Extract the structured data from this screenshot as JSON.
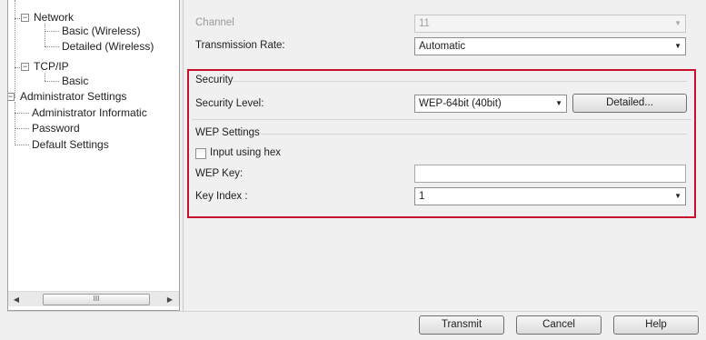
{
  "tree": {
    "items": [
      {
        "label": "Network"
      },
      {
        "label": "Basic (Wireless)"
      },
      {
        "label": "Detailed (Wireless)"
      },
      {
        "label": "TCP/IP"
      },
      {
        "label": "Basic"
      },
      {
        "label": "Administrator Settings"
      },
      {
        "label": "Administrator Informatic"
      },
      {
        "label": "Password"
      },
      {
        "label": "Default Settings"
      }
    ],
    "expanders": [
      "−",
      "−",
      "−"
    ],
    "scrollbar": {
      "left_arrow": "◀",
      "right_arrow": "▶",
      "thumb_grip": "III"
    }
  },
  "form": {
    "channel": {
      "label": "Channel",
      "value": "11"
    },
    "transmission_rate": {
      "label": "Transmission Rate:",
      "value": "Automatic"
    },
    "security": {
      "heading": "Security",
      "level_label": "Security Level:",
      "level_value": "WEP-64bit (40bit)",
      "detailed_button": "Detailed..."
    },
    "wep": {
      "heading": "WEP Settings",
      "hex_checkbox_label": "Input using hex",
      "hex_checked": false,
      "key_label": "WEP Key:",
      "key_value": "",
      "index_label": "Key Index :",
      "index_value": "1"
    },
    "dropdown_arrow": "▼"
  },
  "buttons": {
    "transmit": "Transmit",
    "cancel": "Cancel",
    "help": "Help"
  },
  "highlight_color": "#c8102e"
}
